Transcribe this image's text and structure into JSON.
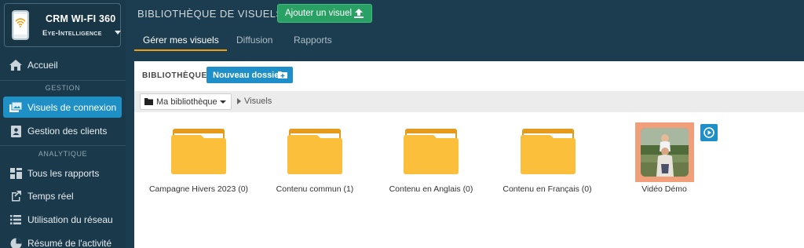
{
  "app": {
    "title": "CRM WI-FI 360",
    "account": "Eye-Intelligence"
  },
  "sidebar": {
    "home": "Accueil",
    "section_gestion": "GESTION",
    "gestion_items": [
      "Visuels de connexion",
      "Gestion des clients"
    ],
    "section_analytique": "ANALYTIQUE",
    "analytique_items": [
      "Tous les rapports",
      "Temps réel",
      "Utilisation du réseau",
      "Résumé de l'activité"
    ]
  },
  "header": {
    "title": "BIBLIOTHÈQUE DE VISUELS",
    "add_button": "Ajouter un visuel",
    "tabs": [
      "Gérer mes visuels",
      "Diffusion",
      "Rapports"
    ]
  },
  "library": {
    "label": "BIBLIOTHÈQUE",
    "new_folder": "Nouveau dossier",
    "breadcrumb_root": "Ma bibliothèque",
    "breadcrumb_current": "Visuels",
    "folders": [
      "Campagne Hivers 2023 (0)",
      "Contenu commun (1)",
      "Contenu en Anglais (0)",
      "Contenu en Français (0)"
    ],
    "video": "Vidéo Démo"
  },
  "colors": {
    "accent": "#1f90c6",
    "success": "#2aa164",
    "tab_underline": "#f39c12",
    "folder": "#fbbf3c"
  }
}
